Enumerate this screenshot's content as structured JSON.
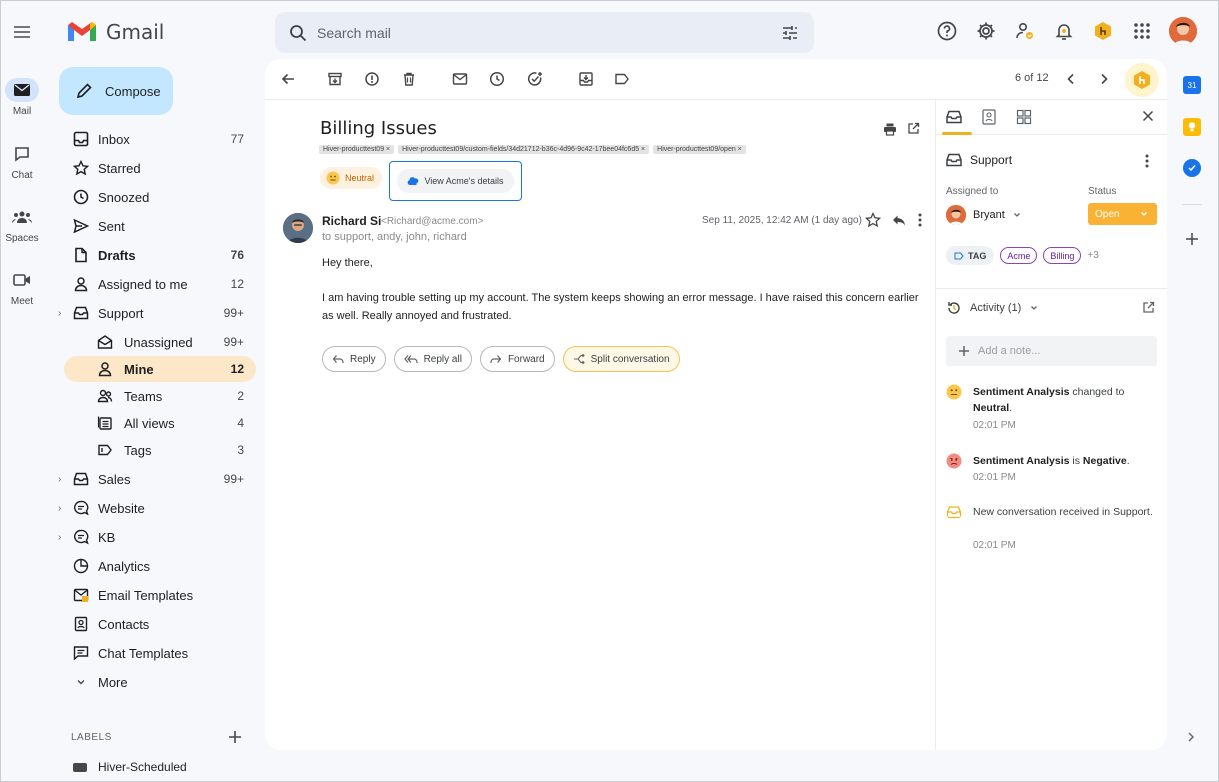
{
  "app": {
    "name": "Gmail"
  },
  "search": {
    "placeholder": "Search mail"
  },
  "rail": [
    {
      "label": "Mail"
    },
    {
      "label": "Chat"
    },
    {
      "label": "Spaces"
    },
    {
      "label": "Meet"
    }
  ],
  "compose": {
    "label": "Compose"
  },
  "nav": {
    "inbox": {
      "label": "Inbox",
      "count": "77"
    },
    "starred": {
      "label": "Starred"
    },
    "snoozed": {
      "label": "Snoozed"
    },
    "sent": {
      "label": "Sent"
    },
    "drafts": {
      "label": "Drafts",
      "count": "76"
    },
    "assigned": {
      "label": "Assigned to me",
      "count": "12"
    },
    "support": {
      "label": "Support",
      "count": "99+"
    },
    "unassigned": {
      "label": "Unassigned",
      "count": "99+"
    },
    "mine": {
      "label": "Mine",
      "count": "12"
    },
    "teams": {
      "label": "Teams",
      "count": "2"
    },
    "allviews": {
      "label": "All views",
      "count": "4"
    },
    "tags": {
      "label": "Tags",
      "count": "3"
    },
    "sales": {
      "label": "Sales",
      "count": "99+"
    },
    "website": {
      "label": "Website"
    },
    "kb": {
      "label": "KB"
    },
    "analytics": {
      "label": "Analytics"
    },
    "templates": {
      "label": "Email Templates"
    },
    "contacts": {
      "label": "Contacts"
    },
    "chat_templates": {
      "label": "Chat Templates"
    },
    "more": {
      "label": "More"
    }
  },
  "labels": {
    "heading": "LABELS",
    "first": "Hiver-Scheduled"
  },
  "toolbar": {
    "pager": "6 of 12"
  },
  "email": {
    "subject": "Billing Issues",
    "label_tags": [
      "Hiver-producttest09 ×",
      "Hiver-producttest09/custom-fields/34d21712-b36c-4d96-9c42-17bee04fc6d5 ×",
      "Hiver-producttest09/open ×"
    ],
    "sentiment": "Neutral",
    "view_details": "View Acme's details",
    "sender_name": "Richard Si",
    "sender_email": "<Richard@acme.com>",
    "to": "to support, andy, john, richard",
    "date": "Sep 11, 2025, 12:42 AM (1 day ago)",
    "greeting": "Hey there,",
    "body": "I am having trouble setting up my account. The system keeps showing an error message. I have raised this concern earlier as well. Really annoyed and frustrated.",
    "actions": {
      "reply": "Reply",
      "reply_all": "Reply all",
      "forward": "Forward",
      "split": "Split conversation"
    }
  },
  "panel": {
    "inbox_name": "Support",
    "assigned_label": "Assigned to",
    "status_label": "Status",
    "assignee": "Bryant",
    "status": "Open",
    "tag_button": "TAG",
    "tags": [
      "Acme",
      "Billing"
    ],
    "more_tags": "+3",
    "activity": "Activity (1)",
    "note_placeholder": "Add a note...",
    "events": [
      {
        "pre": "",
        "bold": "Sentiment Analysis",
        "mid": " changed to ",
        "bold2": "Neutral",
        "post": ".",
        "time": "02:01 PM"
      },
      {
        "pre": "",
        "bold": "Sentiment Analysis",
        "mid": " is ",
        "bold2": "Negative",
        "post": ".",
        "time": "02:01 PM"
      },
      {
        "pre": "New conversation received in Support.",
        "bold": "",
        "mid": "",
        "bold2": "",
        "post": "",
        "time": "02:01 PM"
      }
    ]
  },
  "apps": {
    "calendar_day": "31"
  },
  "colors": {
    "accent": "#f2b01e",
    "compose": "#c2e7ff",
    "active_nav": "#fce8c8",
    "status": "#f9b234"
  }
}
